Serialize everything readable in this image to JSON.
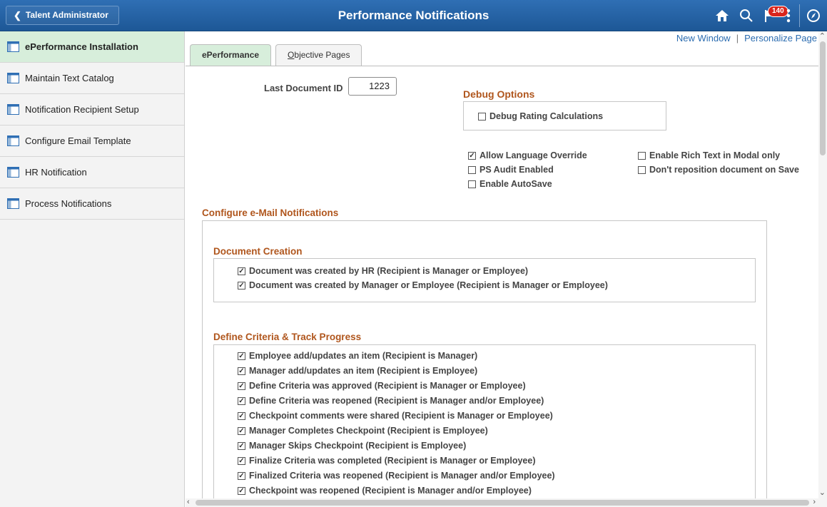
{
  "header": {
    "back_label": "Talent Administrator",
    "title": "Performance Notifications",
    "notification_count": "140",
    "icons": [
      "home-icon",
      "search-icon",
      "notification-flag-icon",
      "actions-menu-icon",
      "navbar-compass-icon"
    ]
  },
  "sidebar": {
    "items": [
      {
        "label": "ePerformance Installation",
        "active": true
      },
      {
        "label": "Maintain Text Catalog"
      },
      {
        "label": "Notification Recipient Setup"
      },
      {
        "label": "Configure Email Template"
      },
      {
        "label": "HR Notification"
      },
      {
        "label": "Process Notifications"
      }
    ]
  },
  "main": {
    "links": {
      "new_window": "New Window",
      "separator": "|",
      "personalize": "Personalize Page"
    },
    "tabs": [
      {
        "label": "ePerformance",
        "active": true
      },
      {
        "label": "Objective Pages"
      }
    ],
    "last_document_id": {
      "label": "Last Document ID",
      "value": "1223"
    },
    "debug": {
      "title": "Debug Options",
      "debug_rating": {
        "label": "Debug Rating Calculations",
        "checked": false
      }
    },
    "options": {
      "allow_language_override": {
        "label": "Allow Language Override",
        "checked": true
      },
      "ps_audit": {
        "label": "PS Audit Enabled",
        "checked": false
      },
      "enable_autosave": {
        "label": "Enable AutoSave",
        "checked": false
      },
      "rich_text_modal": {
        "label": "Enable Rich Text in Modal only",
        "checked": false
      },
      "dont_reposition": {
        "label": "Don't reposition document on Save",
        "checked": false
      }
    },
    "email": {
      "title": "Configure e-Mail Notifications",
      "doc_creation": {
        "title": "Document Creation",
        "items": [
          {
            "label": "Document was created by HR (Recipient is Manager or Employee)",
            "checked": true
          },
          {
            "label": "Document was created by Manager or Employee (Recipient is Manager or Employee)",
            "checked": true
          }
        ]
      },
      "criteria": {
        "title": "Define Criteria & Track Progress",
        "items": [
          {
            "label": "Employee add/updates an item (Recipient is Manager)",
            "checked": true
          },
          {
            "label": "Manager add/updates an item (Recipient is Employee)",
            "checked": true
          },
          {
            "label": "Define Criteria was approved (Recipient is Manager or Employee)",
            "checked": true
          },
          {
            "label": "Define Criteria was reopened (Recipient is Manager and/or Employee)",
            "checked": true
          },
          {
            "label": "Checkpoint comments were shared (Recipient is Manager or Employee)",
            "checked": true
          },
          {
            "label": "Manager Completes Checkpoint (Recipient is Employee)",
            "checked": true
          },
          {
            "label": "Manager Skips Checkpoint (Recipient is Employee)",
            "checked": true
          },
          {
            "label": "Finalize Criteria was completed (Recipient is Manager or Employee)",
            "checked": true
          },
          {
            "label": "Finalized Criteria was reopened (Recipient is Manager and/or Employee)",
            "checked": true
          },
          {
            "label": "Checkpoint was reopened (Recipient is Manager and/or Employee)",
            "checked": true
          }
        ]
      }
    }
  },
  "colors": {
    "header": "#1d5796",
    "active_green": "#d7eedb",
    "section_orange": "#b0561d",
    "link_blue": "#2b6cb0",
    "badge_red": "#d9241c"
  }
}
